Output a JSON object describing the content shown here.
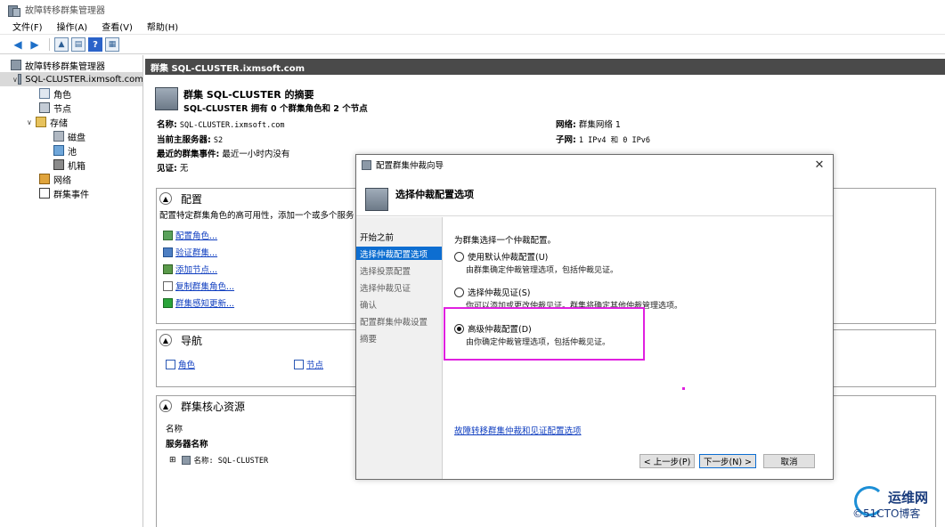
{
  "window": {
    "title": "故障转移群集管理器"
  },
  "menu": [
    "文件(F)",
    "操作(A)",
    "查看(V)",
    "帮助(H)"
  ],
  "tree": {
    "root": "故障转移群集管理器",
    "cluster": "SQL-CLUSTER.ixmsoft.com",
    "roles": "角色",
    "nodes": "节点",
    "storage": "存储",
    "disks": "磁盘",
    "pools": "池",
    "enclosures": "机箱",
    "networks": "网络",
    "events": "群集事件"
  },
  "header": "群集 SQL-CLUSTER.ixmsoft.com",
  "summary": {
    "title": "群集 SQL-CLUSTER 的摘要",
    "subtitle": "SQL-CLUSTER 拥有 0 个群集角色和 2 个节点",
    "name_label": "名称:",
    "name_value": "SQL-CLUSTER.ixmsoft.com",
    "host_label": "当前主服务器:",
    "host_value": "S2",
    "events_label": "最近的群集事件:",
    "events_value": "最近一小时内没有",
    "witness_label": "见证:",
    "witness_value": "无",
    "network_label": "网络:",
    "network_value": "群集网络 1",
    "subnet_label": "子网:",
    "subnet_value": "1 IPv4 和 0 IPv6"
  },
  "config_panel": {
    "title": "配置",
    "desc": "配置特定群集角色的高可用性，添加一个或多个服务",
    "links": [
      "配置角色...",
      "验证群集...",
      "添加节点...",
      "复制群集角色...",
      "群集感知更新..."
    ]
  },
  "nav_panel": {
    "title": "导航",
    "links": [
      "角色",
      "节点"
    ]
  },
  "core_panel": {
    "title": "群集核心资源",
    "col_name": "名称",
    "group": "服务器名称",
    "row": "名称: SQL-CLUSTER"
  },
  "dialog": {
    "title": "配置群集仲裁向导",
    "heading": "选择仲裁配置选项",
    "steps": [
      "开始之前",
      "选择仲裁配置选项",
      "选择投票配置",
      "选择仲裁见证",
      "确认",
      "配置群集仲裁设置",
      "摘要"
    ],
    "prompt": "为群集选择一个仲裁配置。",
    "options": [
      {
        "label": "使用默认仲裁配置(U)",
        "desc": "由群集确定仲裁管理选项，包括仲裁见证。",
        "selected": false
      },
      {
        "label": "选择仲裁见证(S)",
        "desc": "你可以添加或更改仲裁见证。群集将确定其他仲裁管理选项。",
        "selected": false
      },
      {
        "label": "高级仲裁配置(D)",
        "desc": "由你确定仲裁管理选项，包括仲裁见证。",
        "selected": true
      }
    ],
    "help_link": "故障转移群集仲裁和见证配置选项",
    "buttons": {
      "back": "< 上一步(P)",
      "next": "下一步(N) >",
      "cancel": "取消"
    }
  },
  "watermark": {
    "line1": "运维网",
    "line2": "©51CTO博客"
  },
  "colors": {
    "highlight": "#e020e0",
    "selected_step": "#0d6ed1",
    "link": "#0d3cbf"
  }
}
